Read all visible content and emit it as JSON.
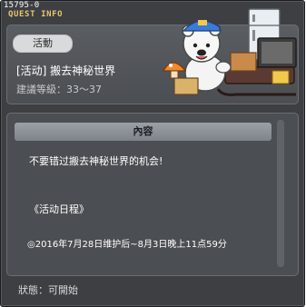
{
  "window": {
    "quest_id": "15795-0",
    "title": "QUEST INFO"
  },
  "quest": {
    "category": "活動",
    "name": "[活动] 搬去神秘世界",
    "level": "建議等級：33～37"
  },
  "content": {
    "header": "內容",
    "lines": [
      "不要错过搬去神秘世界的机会!",
      "《活动日程》",
      "◎2016年7月28日维护后~8月3日晚上11点59分"
    ]
  },
  "footer": {
    "status": "狀態：可開始"
  },
  "icons": [
    "polar-bear-illustration",
    "fridge-icon",
    "tv-icon",
    "sled-icon",
    "mushroom-icon"
  ],
  "colors": {
    "window_bg": "#3d3f42",
    "title_gold": "#e6c66e",
    "panel_bg": "#4b4e52",
    "header_bar": "#8a9096"
  }
}
